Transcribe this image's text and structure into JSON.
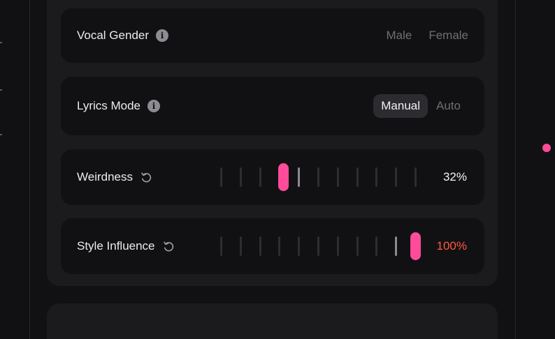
{
  "colors": {
    "accent": "#ff4b9a",
    "max_value": "#ff5a3c"
  },
  "vocal_gender": {
    "label": "Vocal Gender",
    "info_icon": "info-icon",
    "options": [
      "Male",
      "Female"
    ]
  },
  "lyrics_mode": {
    "label": "Lyrics Mode",
    "info_icon": "info-icon",
    "options": [
      "Manual",
      "Auto"
    ],
    "selected": "Manual"
  },
  "weirdness": {
    "label": "Weirdness",
    "reset_icon": "reset-icon",
    "value": 32,
    "value_text": "32%"
  },
  "style_influence": {
    "label": "Style Influence",
    "reset_icon": "reset-icon",
    "value": 100,
    "value_text": "100%"
  }
}
